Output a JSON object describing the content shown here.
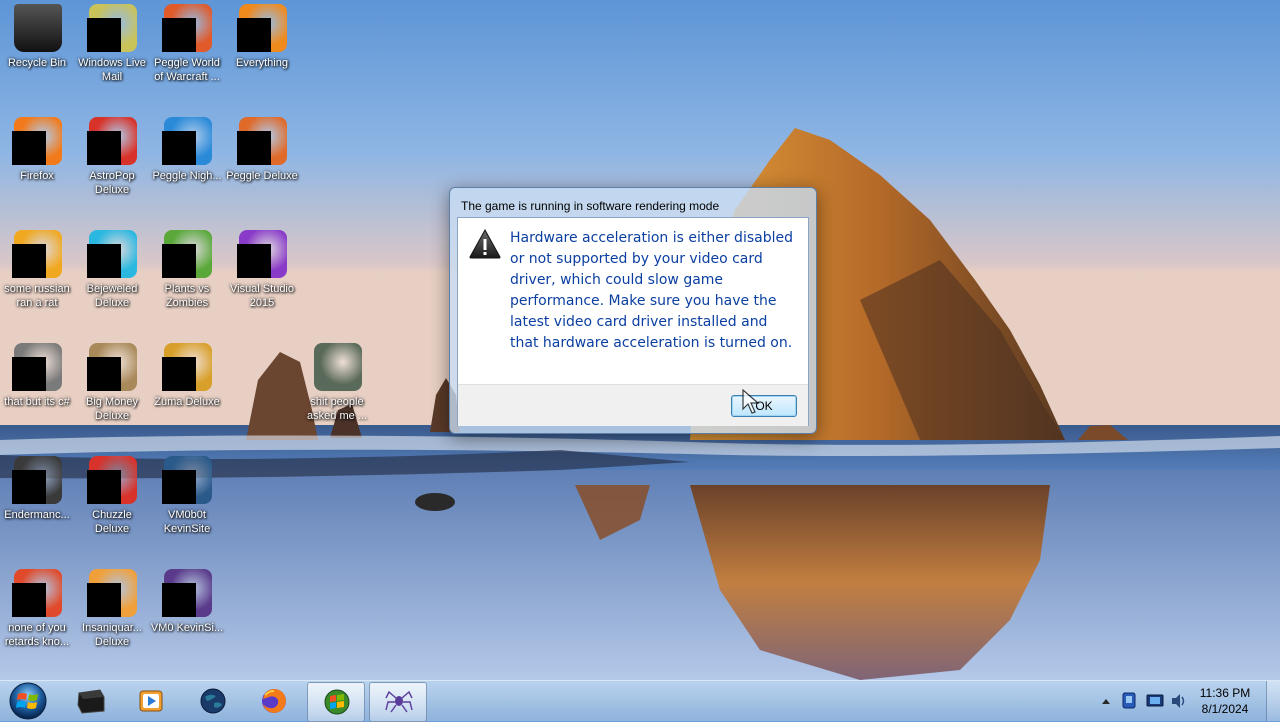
{
  "desktop": {
    "icons": [
      {
        "label": "Recycle Bin",
        "icon": "recycle-bin-icon",
        "color": "#333333"
      },
      {
        "label": "Windows Live Mail",
        "icon": "mail-icon",
        "color": "#c9c35a"
      },
      {
        "label": "Peggle World of Warcraft ...",
        "icon": "peggle-icon",
        "color": "#e05a2a"
      },
      {
        "label": "Everything",
        "icon": "everything-icon",
        "color": "#f08a1c"
      },
      {
        "label": "Firefox",
        "icon": "firefox-icon",
        "color": "#f27a1a"
      },
      {
        "label": "AstroPop Deluxe",
        "icon": "astropop-icon",
        "color": "#d8332a"
      },
      {
        "label": "Peggle Nigh...",
        "icon": "peggle-nights-icon",
        "color": "#2a8ad8"
      },
      {
        "label": "Peggle Deluxe",
        "icon": "peggle-deluxe-icon",
        "color": "#e06a2a"
      },
      {
        "label": "some russian ran a rat",
        "icon": "file-icon",
        "color": "#f0a820"
      },
      {
        "label": "Bejeweled Deluxe",
        "icon": "bejeweled-icon",
        "color": "#2ab8e0"
      },
      {
        "label": "Plants vs Zombies",
        "icon": "pvz-icon",
        "color": "#5aa83a"
      },
      {
        "label": "Visual Studio 2015",
        "icon": "visual-studio-icon",
        "color": "#8a3ac8"
      },
      {
        "label": "that but its c#",
        "icon": "shortcut-icon",
        "color": "#7a7a7a"
      },
      {
        "label": "Big Money Deluxe",
        "icon": "big-money-icon",
        "color": "#a88a5a"
      },
      {
        "label": "Zuma Deluxe",
        "icon": "zuma-icon",
        "color": "#d8a02a"
      },
      {
        "label": "shit people asked me ...",
        "icon": "folder-icon",
        "color": "#5a6a5a"
      },
      {
        "label": "Endermanc...",
        "icon": "endermanch-icon",
        "color": "#3a3a3a"
      },
      {
        "label": "Chuzzle Deluxe",
        "icon": "chuzzle-icon",
        "color": "#d8322a"
      },
      {
        "label": "VM0b0t KevinSite",
        "icon": "vm-icon",
        "color": "#2a5a8a"
      },
      {
        "label": "none of you retards kno...",
        "icon": "chrome-like-icon",
        "color": "#e04a2a"
      },
      {
        "label": "Insaniquar... Deluxe",
        "icon": "insaniquarium-icon",
        "color": "#f0a03a"
      },
      {
        "label": "VM0 KevinSi...",
        "icon": "vm2-icon",
        "color": "#5a3a8a"
      }
    ]
  },
  "dialog": {
    "title": "The game is running in software rendering mode",
    "message": "Hardware acceleration is either disabled or not supported by your video card driver, which could slow game performance. Make sure you have the latest video card driver installed and that hardware acceleration is turned on.",
    "ok_label": "OK",
    "icon": "warning-icon"
  },
  "taskbar": {
    "items": [
      {
        "name": "start-button",
        "icon": "windows-logo-icon"
      },
      {
        "name": "taskbar-item-app1",
        "icon": "black-box-icon"
      },
      {
        "name": "taskbar-item-media",
        "icon": "media-player-icon"
      },
      {
        "name": "taskbar-item-globe",
        "icon": "globe-icon"
      },
      {
        "name": "taskbar-item-firefox",
        "icon": "firefox-icon"
      },
      {
        "name": "taskbar-item-windows-game",
        "icon": "windows-flag-icon"
      },
      {
        "name": "taskbar-item-spider",
        "icon": "spider-icon"
      }
    ],
    "tray": [
      "show-hidden-icons-icon",
      "network-icon",
      "display-icon",
      "volume-icon"
    ],
    "clock_time": "11:36 PM",
    "clock_date": "8/1/2024"
  }
}
